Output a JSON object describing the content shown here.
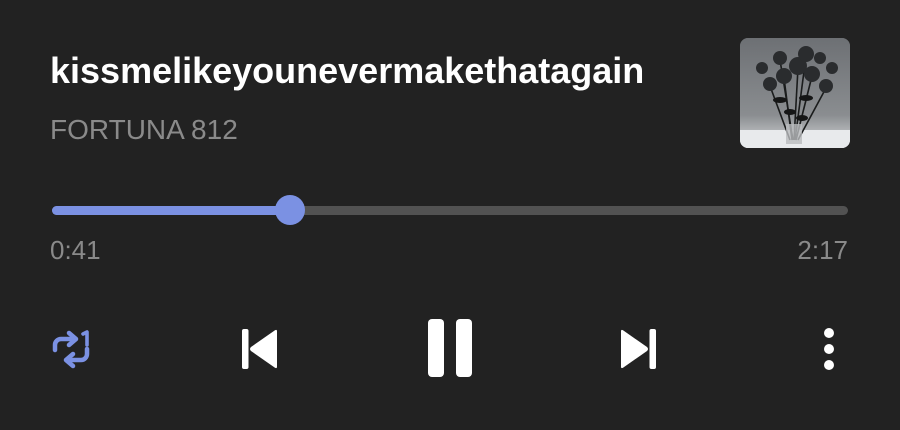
{
  "track": {
    "title": "kissmelikeyounevermakethatagain",
    "artist": "FORTUNA 812"
  },
  "album_art": {
    "description": "bouquet-of-dried-roses"
  },
  "playback": {
    "elapsed": "0:41",
    "duration": "2:17",
    "progress_fraction": 0.299,
    "state": "playing"
  },
  "controls": {
    "repeat_icon": "repeat-one-icon",
    "previous_icon": "skip-previous-icon",
    "pause_icon": "pause-icon",
    "next_icon": "skip-next-icon",
    "more_icon": "more-vert-icon"
  },
  "colors": {
    "background": "#222222",
    "accent": "#7b91e3",
    "track_inactive": "#525252",
    "text_primary": "#ffffff",
    "text_secondary": "#8a8a8a"
  }
}
